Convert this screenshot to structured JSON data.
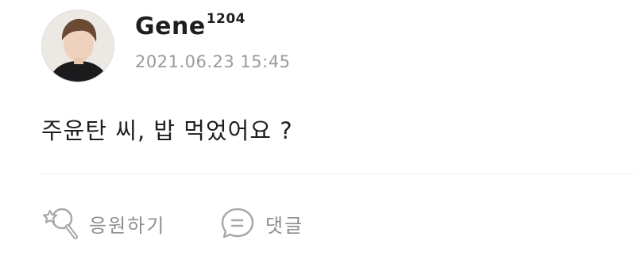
{
  "post": {
    "username": "Gene",
    "username_suffix": "1204",
    "timestamp": "2021.06.23 15:45",
    "message": "주윤탄 씨, 밥 먹었어요 ?"
  },
  "actions": {
    "cheer_label": "응원하기",
    "comment_label": "댓글"
  },
  "icons": {
    "cheer": "magnifier-star-icon",
    "comment": "speech-bubble-icon"
  },
  "colors": {
    "text": "#1e1e1e",
    "muted": "#9a9a9a",
    "icon": "#a8a8a8",
    "divider": "#ececec"
  }
}
